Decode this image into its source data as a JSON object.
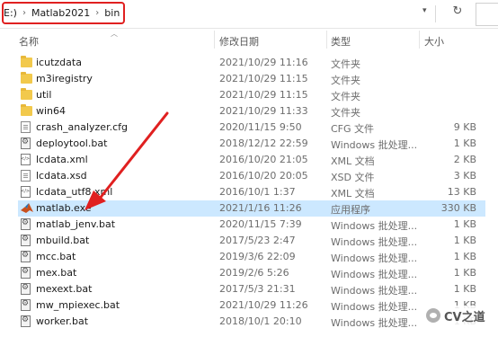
{
  "breadcrumb": {
    "drive": "E:)",
    "folder1": "Matlab2021",
    "folder2": "bin",
    "separator": "›"
  },
  "toolbar": {
    "dropdown_icon": "chevron-down-icon",
    "refresh_icon": "refresh-icon"
  },
  "columns": {
    "name": "名称",
    "date": "修改日期",
    "type": "类型",
    "size": "大小"
  },
  "files": [
    {
      "name": "icutzdata",
      "date": "2021/10/29 11:16",
      "type": "文件夹",
      "size": "",
      "icon": "folder-icon"
    },
    {
      "name": "m3iregistry",
      "date": "2021/10/29 11:15",
      "type": "文件夹",
      "size": "",
      "icon": "folder-icon"
    },
    {
      "name": "util",
      "date": "2021/10/29 11:15",
      "type": "文件夹",
      "size": "",
      "icon": "folder-icon"
    },
    {
      "name": "win64",
      "date": "2021/10/29 11:33",
      "type": "文件夹",
      "size": "",
      "icon": "folder-icon"
    },
    {
      "name": "crash_analyzer.cfg",
      "date": "2020/11/15 9:50",
      "type": "CFG 文件",
      "size": "9 KB",
      "icon": "file-icon"
    },
    {
      "name": "deploytool.bat",
      "date": "2018/12/12 22:59",
      "type": "Windows 批处理...",
      "size": "1 KB",
      "icon": "batch-file-icon"
    },
    {
      "name": "lcdata.xml",
      "date": "2016/10/20 21:05",
      "type": "XML 文档",
      "size": "2 KB",
      "icon": "xml-file-icon"
    },
    {
      "name": "lcdata.xsd",
      "date": "2016/10/20 20:05",
      "type": "XSD 文件",
      "size": "3 KB",
      "icon": "file-icon"
    },
    {
      "name": "lcdata_utf8.xml",
      "date": "2016/10/1 1:37",
      "type": "XML 文档",
      "size": "13 KB",
      "icon": "xml-file-icon"
    },
    {
      "name": "matlab.exe",
      "date": "2021/1/16 11:26",
      "type": "应用程序",
      "size": "330 KB",
      "icon": "matlab-icon",
      "selected": true
    },
    {
      "name": "matlab_jenv.bat",
      "date": "2020/11/15 7:39",
      "type": "Windows 批处理...",
      "size": "1 KB",
      "icon": "batch-file-icon"
    },
    {
      "name": "mbuild.bat",
      "date": "2017/5/23 2:47",
      "type": "Windows 批处理...",
      "size": "1 KB",
      "icon": "batch-file-icon"
    },
    {
      "name": "mcc.bat",
      "date": "2019/3/6 22:09",
      "type": "Windows 批处理...",
      "size": "1 KB",
      "icon": "batch-file-icon"
    },
    {
      "name": "mex.bat",
      "date": "2019/2/6 5:26",
      "type": "Windows 批处理...",
      "size": "1 KB",
      "icon": "batch-file-icon"
    },
    {
      "name": "mexext.bat",
      "date": "2017/5/3 21:31",
      "type": "Windows 批处理...",
      "size": "1 KB",
      "icon": "batch-file-icon"
    },
    {
      "name": "mw_mpiexec.bat",
      "date": "2021/10/29 11:26",
      "type": "Windows 批处理...",
      "size": "1 KB",
      "icon": "batch-file-icon"
    },
    {
      "name": "worker.bat",
      "date": "2018/10/1 20:10",
      "type": "Windows 批处理...",
      "size": "1 KB",
      "icon": "batch-file-icon"
    }
  ],
  "watermark": {
    "text": "CV之道"
  },
  "colors": {
    "highlight_box": "#e02020",
    "selected_row": "#cce8ff",
    "annotation_arrow": "#e02020"
  }
}
